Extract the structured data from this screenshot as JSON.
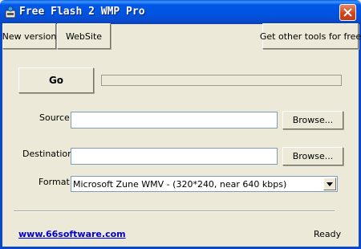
{
  "window": {
    "title": "Free Flash 2 WMP Pro",
    "close_icon": "close-icon",
    "app_icon": "app-icon"
  },
  "toolbar": {
    "new_version_label": "New version",
    "website_label": "WebSite",
    "other_tools_label": "Get other tools for free"
  },
  "main": {
    "go_label": "Go",
    "progress_percent": 0,
    "source_label": "Source",
    "source_value": "",
    "destination_label": "Destination",
    "destination_value": "",
    "browse_label": "Browse...",
    "format_label": "Format",
    "format_selected": "Microsoft Zune WMV - (320*240, near 640 kbps)"
  },
  "footer": {
    "link_text": "www.66software.com",
    "status_text": "Ready"
  },
  "colors": {
    "titlebar": "#0053e1",
    "face": "#ece9d8",
    "close": "#d1441c",
    "link": "#0000cc"
  }
}
